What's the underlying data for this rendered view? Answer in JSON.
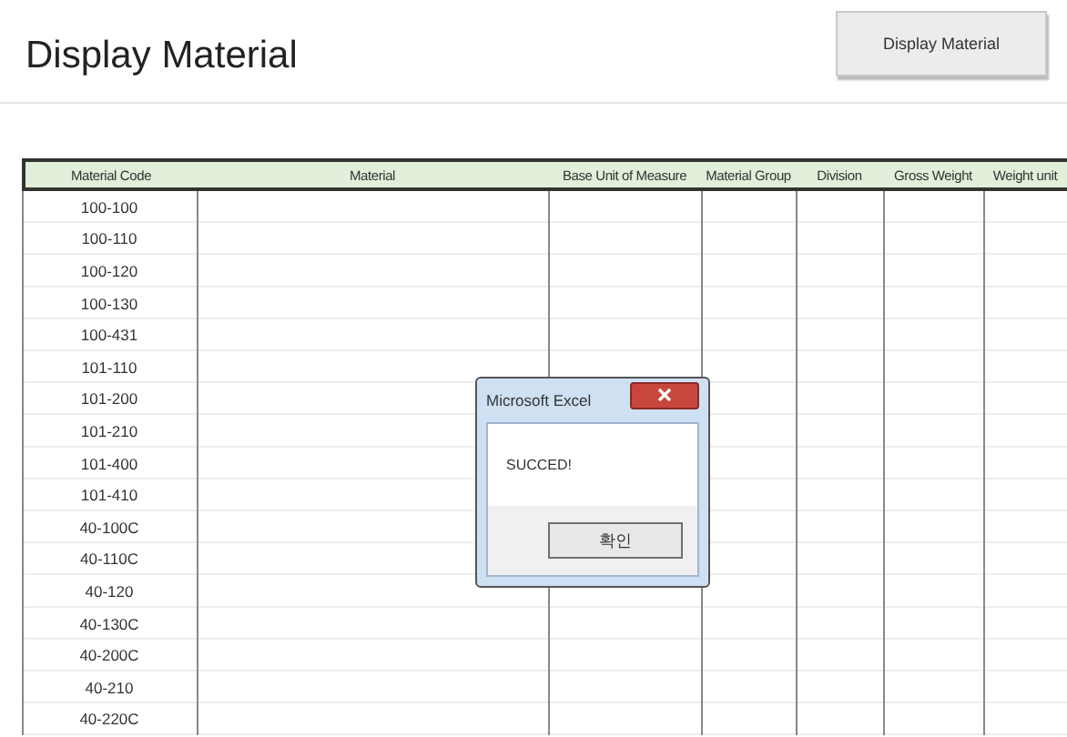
{
  "title": "Display Material",
  "action_button": "Display Material",
  "table": {
    "columns": [
      "Material Code",
      "Material",
      "Base Unit of Measure",
      "Material Group",
      "Division",
      "Gross Weight",
      "Weight unit"
    ],
    "rows": [
      "100-100",
      "100-110",
      "100-120",
      "100-130",
      "100-431",
      "101-110",
      "101-200",
      "101-210",
      "101-400",
      "101-410",
      "40-100C",
      "40-110C",
      "40-120",
      "40-130C",
      "40-200C",
      "40-210",
      "40-220C"
    ]
  },
  "dialog": {
    "title": "Microsoft Excel",
    "message": "SUCCED!",
    "button": "확인"
  }
}
